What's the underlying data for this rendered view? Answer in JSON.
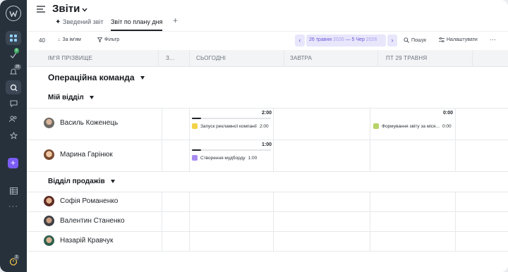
{
  "header": {
    "title": "Звіти",
    "tabs": [
      {
        "label": "Зведений звіт"
      },
      {
        "label": "Звіт по плану дня"
      }
    ],
    "add_tab": "+"
  },
  "rail": {
    "badge_1": "8",
    "badge_2": "25",
    "badge_3": "2"
  },
  "toolbar": {
    "count": "40",
    "sort_label": "За ім'ям",
    "filter_label": "Фільтр",
    "date_from": "26 травня",
    "year_from": "2026",
    "date_sep": "—",
    "date_to": "5 Чер",
    "year_to": "2026",
    "search_label": "Пошук",
    "settings_label": "Налаштувати",
    "more": "···"
  },
  "columns": {
    "name": "ІМ'Я ПРІЗВИЩЕ",
    "collapsed": "З...",
    "today": "СЬОГОДНІ",
    "tomorrow": "ЗАВТРА",
    "friday": "ПТ 29 ТРАВНЯ"
  },
  "groups": {
    "team": "Операційна команда",
    "dept1": "Мій відділ",
    "dept2": "Відділ продажів"
  },
  "people": [
    {
      "name": "Василь Коженець"
    },
    {
      "name": "Марина Гарінюк"
    },
    {
      "name": "Софія Романенко"
    },
    {
      "name": "Валентин Станенко"
    },
    {
      "name": "Назарій Кравчук"
    }
  ],
  "tasks": {
    "p1_today_total": "2:00",
    "p1_today_task": "Запуск рекламної компанії",
    "p1_today_time": "2:00",
    "p1_today_progress": 0.12,
    "p1_fri_total": "0:00",
    "p1_fri_task": "Формування звіту за міся...",
    "p1_fri_time": "0:00",
    "p2_today_total": "1:00",
    "p2_today_task": "Створення мудборду",
    "p2_today_time": "1:00",
    "p2_today_progress": 0.12
  },
  "colors": {
    "accent": "#7b5cf5",
    "rail": "#26313c",
    "task_yellow": "#f3d34a",
    "task_green": "#b7d36a",
    "task_purple": "#a98cf2"
  }
}
